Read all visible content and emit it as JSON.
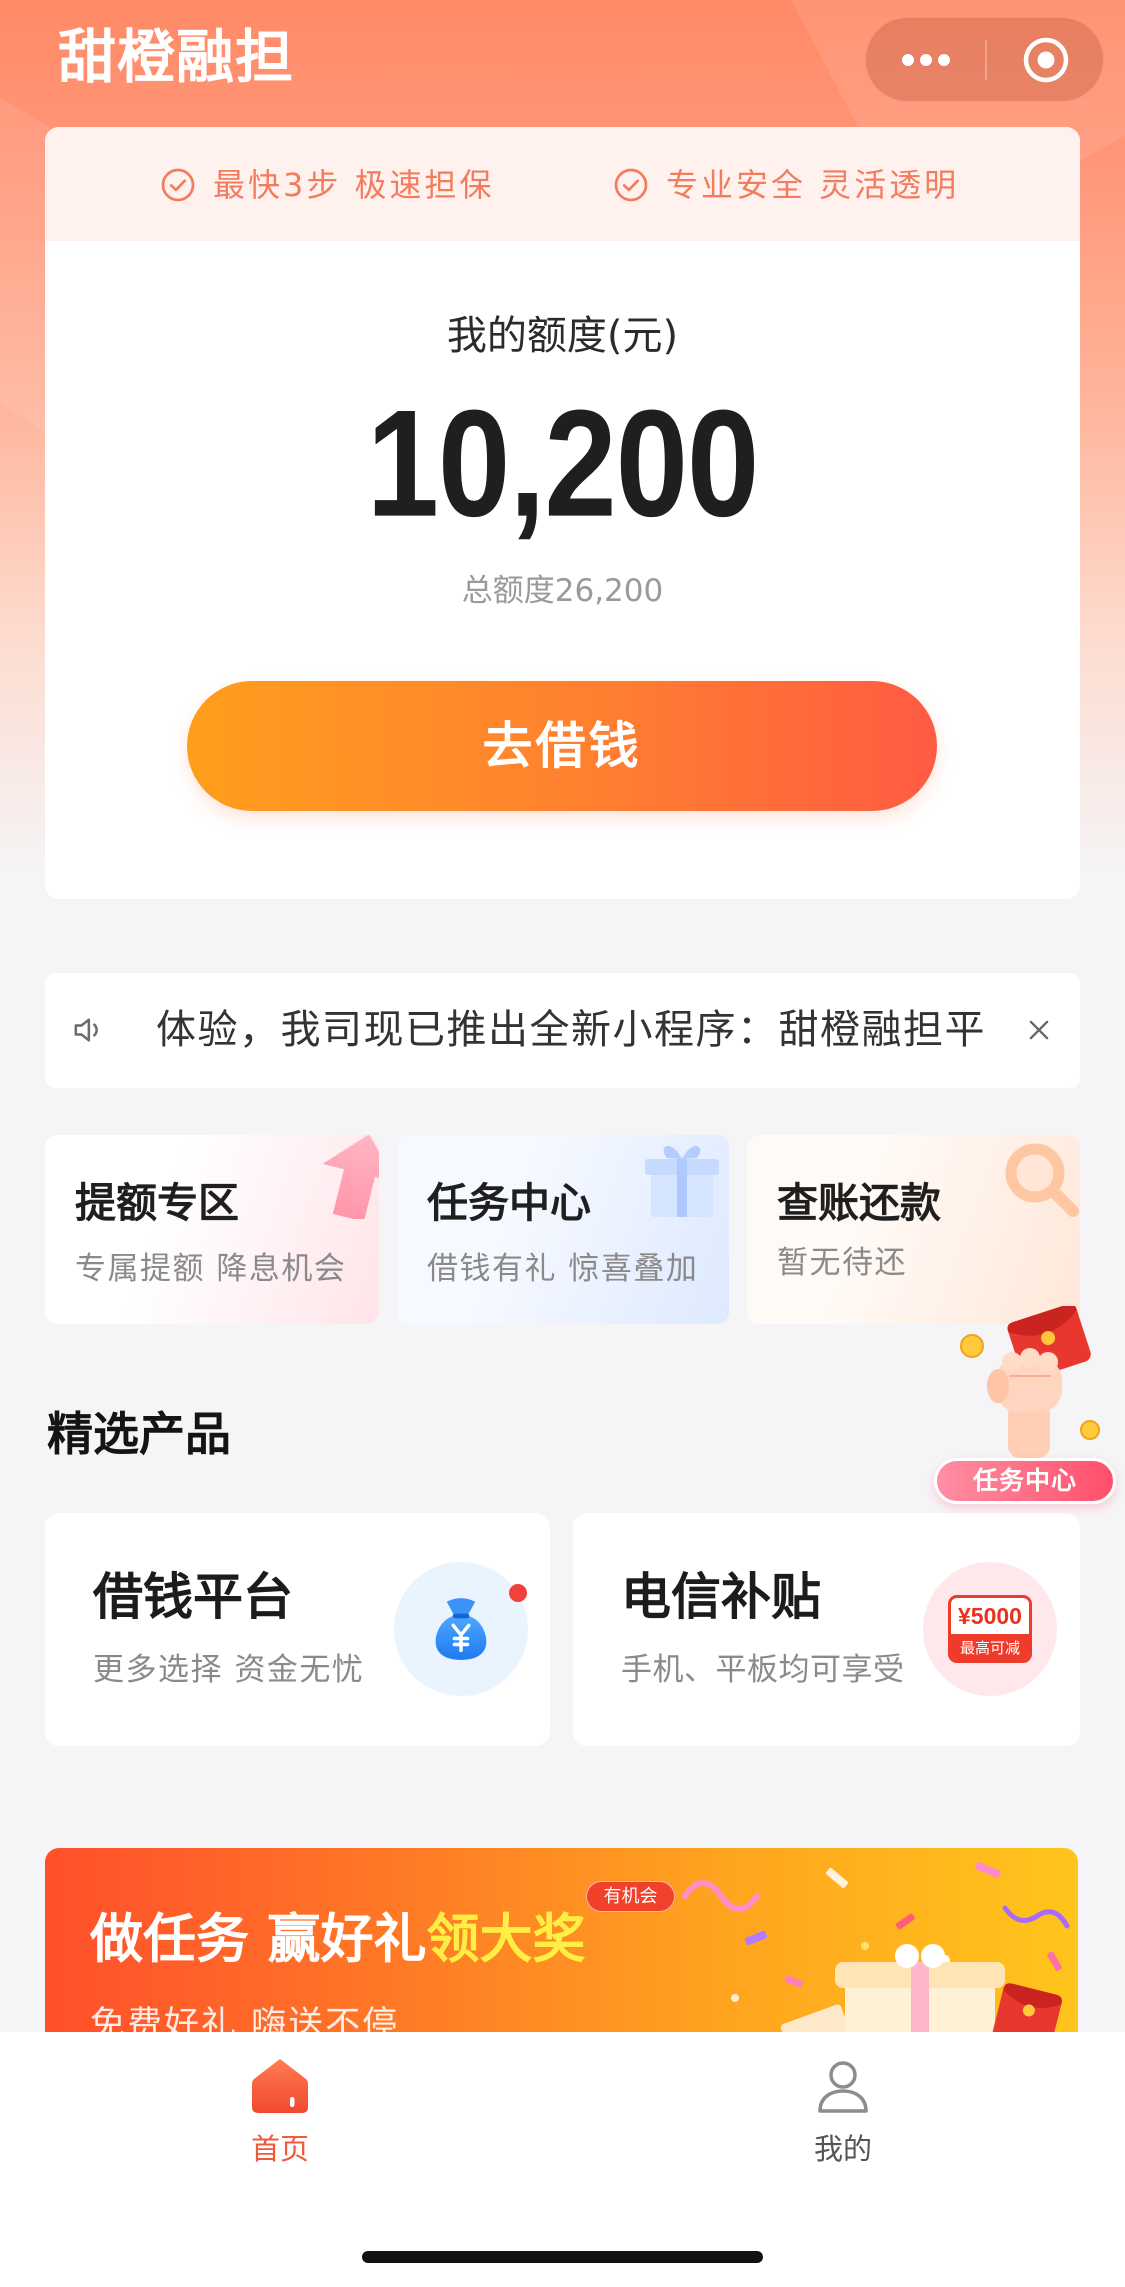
{
  "app": {
    "title": "甜橙融担"
  },
  "capsule": {
    "icons": [
      "more-dots-icon",
      "target-circle-icon"
    ]
  },
  "quota_card": {
    "features": [
      {
        "icon": "check-circle-icon",
        "text": "最快3步 极速担保"
      },
      {
        "icon": "check-circle-icon",
        "text": "专业安全 灵活透明"
      }
    ],
    "label": "我的额度(元)",
    "amount": "10,200",
    "total": "总额度26,200",
    "cta": "去借钱"
  },
  "notice": {
    "icon": "speaker-icon",
    "text": "体验，我司现已推出全新小程序：甜橙融担平",
    "close_icon": "close-icon"
  },
  "quick_entries": [
    {
      "title": "提额专区",
      "subtitle": "专属提额 降息机会",
      "icon": "arrow-up-icon"
    },
    {
      "title": "任务中心",
      "subtitle": "借钱有礼 惊喜叠加",
      "icon": "gift-icon"
    },
    {
      "title": "查账还款",
      "subtitle": "暂无待还",
      "icon": "magnifier-icon"
    }
  ],
  "floating_badge": {
    "label": "任务中心",
    "icon": "red-envelope-hand-icon"
  },
  "products_section": {
    "title": "精选产品",
    "items": [
      {
        "title": "借钱平台",
        "subtitle": "更多选择 资金无忧",
        "icon": "money-bag-icon",
        "has_notification_dot": true
      },
      {
        "title": "电信补贴",
        "subtitle": "手机、平板均可享受",
        "icon": "coupon-badge-icon",
        "badge_amount": "¥5000",
        "badge_caption": "最高可减"
      }
    ]
  },
  "banner": {
    "title": "做任务 赢好礼",
    "highlight": "领大奖",
    "tag": "有机会",
    "subtitle": "免费好礼 嗨送不停"
  },
  "tabbar": {
    "items": [
      {
        "label": "首页",
        "icon": "home-icon",
        "active": true
      },
      {
        "label": "我的",
        "icon": "user-icon",
        "active": false
      }
    ]
  },
  "colors": {
    "brand": "#FF8A66",
    "accent": "#F05A3A",
    "cta_start": "#FF9E1C",
    "cta_end": "#FF5B42",
    "feature_text": "#F47C5E",
    "highlight_yellow": "#FFEE44",
    "page_background": "#F5F5F7"
  }
}
